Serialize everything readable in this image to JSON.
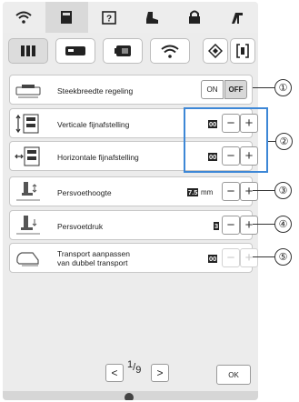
{
  "top_tabs": [
    {
      "icon": "wifi-icon",
      "active": false
    },
    {
      "icon": "document-icon",
      "active": true
    },
    {
      "icon": "help-icon",
      "active": false
    },
    {
      "icon": "boot-icon",
      "active": false
    },
    {
      "icon": "lock-icon",
      "active": false
    },
    {
      "icon": "machine-icon",
      "active": false
    }
  ],
  "sub_tabs": [
    {
      "icon": "sewing-settings-icon",
      "active": true
    },
    {
      "icon": "embroidery-settings-icon",
      "active": false
    },
    {
      "icon": "general-settings-icon",
      "active": false
    },
    {
      "icon": "wifi-settings-icon",
      "active": false
    }
  ],
  "settings": {
    "stitch_width": {
      "label": "Steekbreedte regeling",
      "on_label": "ON",
      "off_label": "OFF",
      "selected": "OFF"
    },
    "vertical_fine": {
      "label": "Verticale fijnafstelling",
      "value": "00"
    },
    "horizontal_fine": {
      "label": "Horizontale fijnafstelling",
      "value": "00"
    },
    "presser_height": {
      "label": "Persvoethoogte",
      "value": "7.5",
      "unit": "mm"
    },
    "presser_pressure": {
      "label": "Persvoetdruk",
      "value": "3"
    },
    "dual_feed": {
      "label_line1": "Transport aanpassen",
      "label_line2": "van dubbel transport",
      "value": "00",
      "enabled": false
    }
  },
  "pager": {
    "current": "1",
    "total": "9",
    "prev": "<",
    "next": ">"
  },
  "ok_label": "OK",
  "callouts": [
    "①",
    "②",
    "③",
    "④",
    "⑤"
  ],
  "colors": {
    "accent": "#3d87d6",
    "active_tab": "#d9d9d9"
  }
}
